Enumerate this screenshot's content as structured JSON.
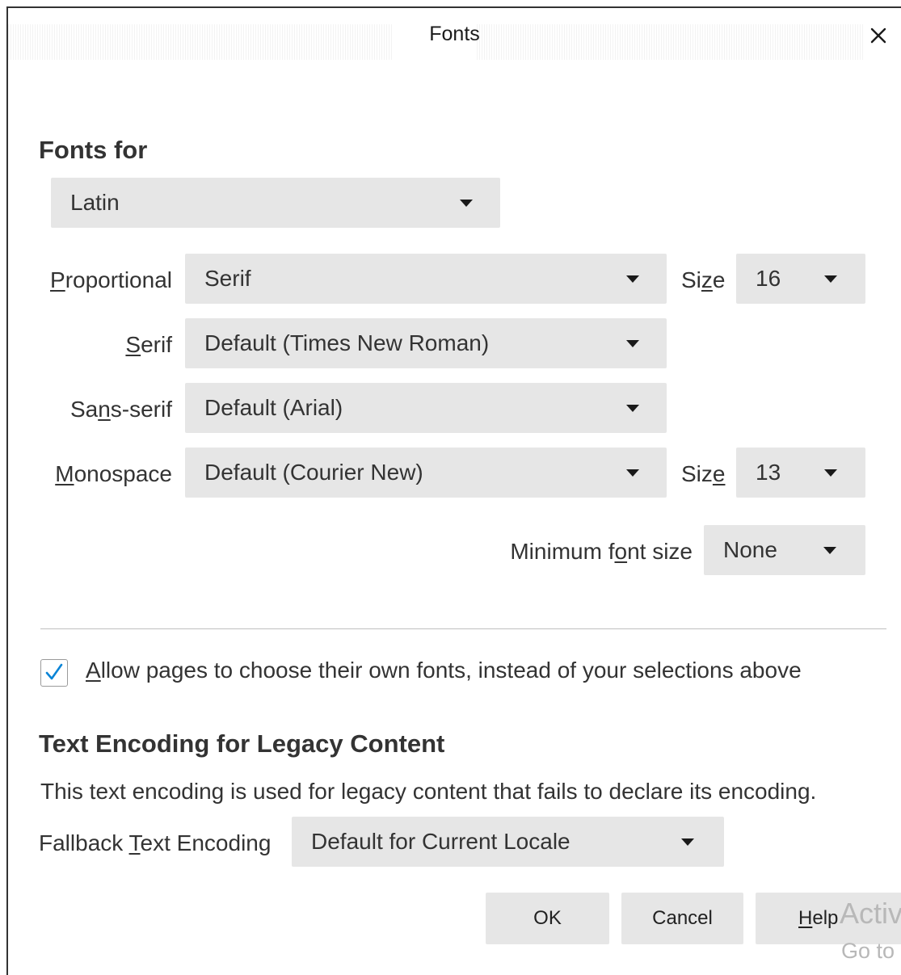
{
  "window": {
    "title": "Fonts",
    "close_icon": "close-icon"
  },
  "fonts_for": {
    "heading": "Fonts for",
    "language_value": "Latin"
  },
  "proportional": {
    "label_pre": "",
    "label_key": "P",
    "label_post": "roportional",
    "value": "Serif",
    "size_label_pre": "Si",
    "size_label_key": "z",
    "size_label_post": "e",
    "size_value": "16"
  },
  "serif": {
    "label_pre": "",
    "label_key": "S",
    "label_post": "erif",
    "value": "Default (Times New Roman)"
  },
  "sans_serif": {
    "label_pre": "Sa",
    "label_key": "n",
    "label_post": "s-serif",
    "value": "Default (Arial)"
  },
  "monospace": {
    "label_pre": "",
    "label_key": "M",
    "label_post": "onospace",
    "value": "Default (Courier New)",
    "size_label_pre": "Siz",
    "size_label_key": "e",
    "size_label_post": "",
    "size_value": "13"
  },
  "minimum_font_size": {
    "label_pre": "Minimum f",
    "label_key": "o",
    "label_post": "nt size",
    "value": "None"
  },
  "allow_pages": {
    "checked": true,
    "label_pre": "",
    "label_key": "A",
    "label_post": "llow pages to choose their own fonts, instead of your selections above"
  },
  "text_encoding": {
    "heading": "Text Encoding for Legacy Content",
    "description": "This text encoding is used for legacy content that fails to declare its encoding.",
    "label_pre": "Fallback ",
    "label_key": "T",
    "label_post": "ext Encoding",
    "value": "Default for Current Locale"
  },
  "buttons": {
    "ok": "OK",
    "cancel": "Cancel",
    "help_key": "H",
    "help_post": "elp"
  },
  "watermark": {
    "line1": "Activ",
    "line2": "Go to"
  },
  "colors": {
    "dropdown_bg": "#e6e6e6",
    "check_color": "#0a84d6",
    "text": "#333333"
  }
}
